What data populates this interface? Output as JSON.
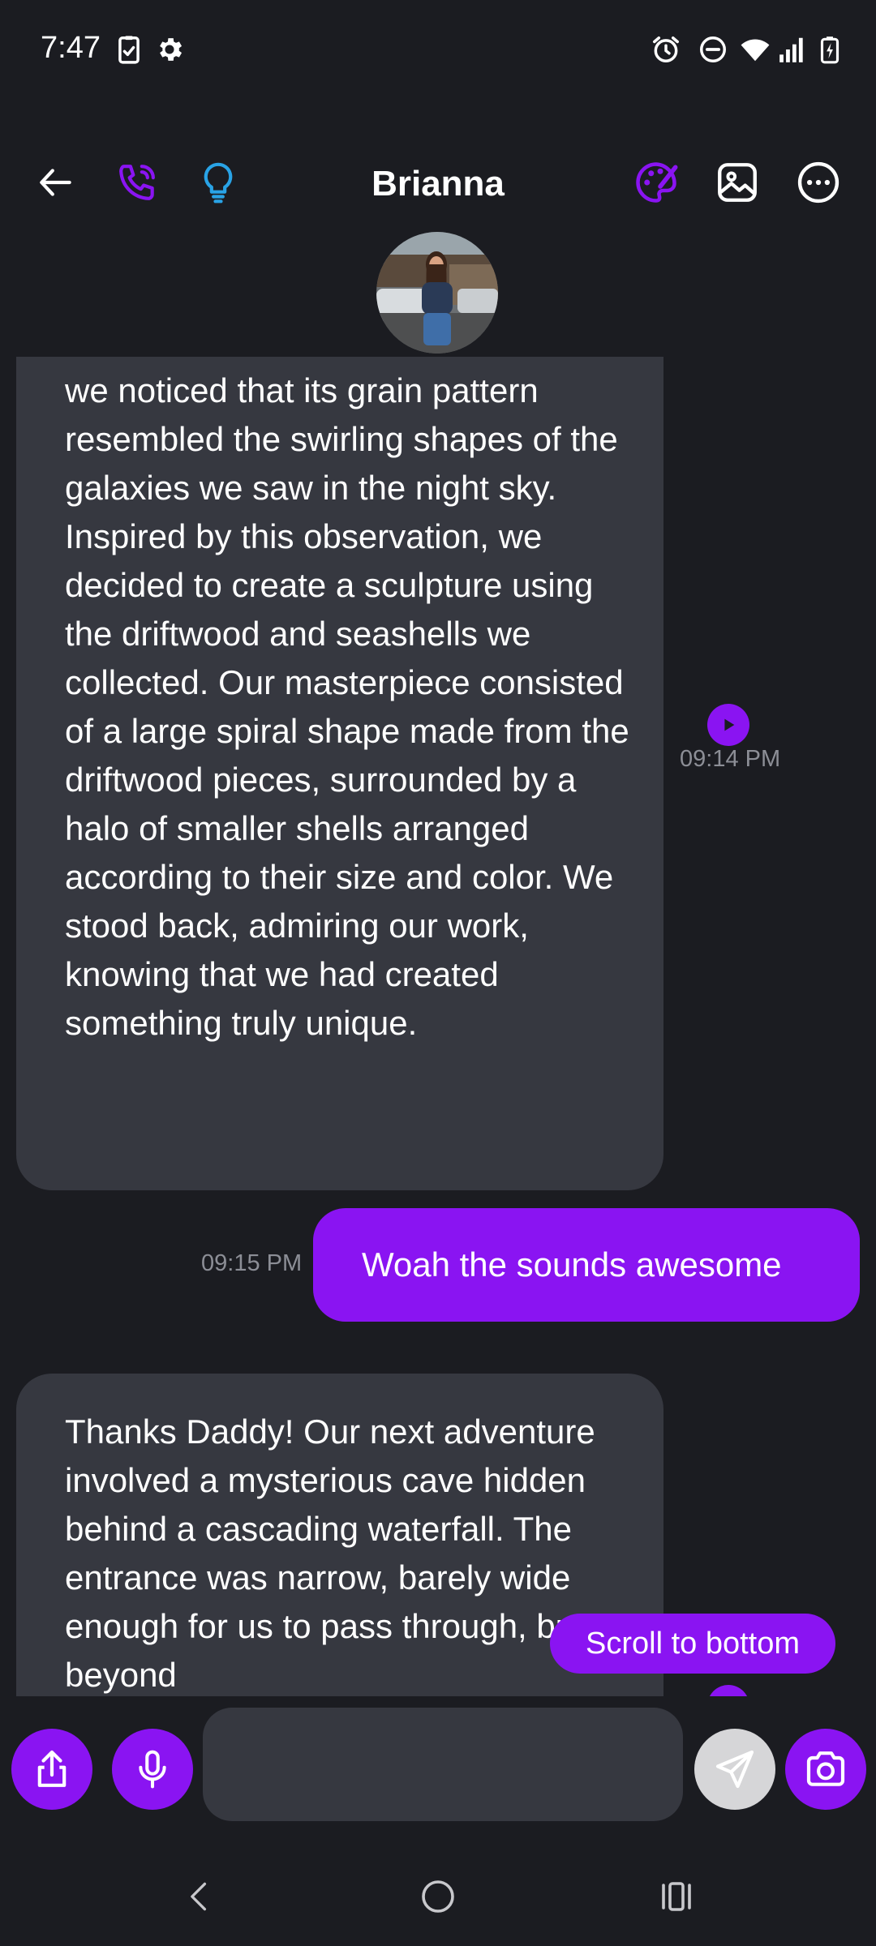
{
  "status_bar": {
    "time": "7:47",
    "left_icons": [
      "clipboard-check-icon",
      "gear-icon"
    ],
    "right_icons": [
      "alarm-icon",
      "do-not-disturb-icon",
      "wifi-icon",
      "signal-icon",
      "battery-charging-icon"
    ]
  },
  "header": {
    "contact_name": "Brianna",
    "icons": [
      "back-arrow-icon",
      "phone-icon",
      "lightbulb-icon",
      "palette-icon",
      "image-icon",
      "more-icon"
    ],
    "avatar_icon": "contact-avatar"
  },
  "messages": [
    {
      "sender": "contact",
      "text": "we noticed that its grain pattern resembled the swirling shapes of the galaxies we saw in the night sky. Inspired by this observation, we decided to create a sculpture using the driftwood and seashells we collected. Our masterpiece consisted of a large spiral shape made from the driftwood pieces, surrounded by a halo of smaller shells arranged according to their size and color. We stood back, admiring our work, knowing that we had created something truly unique.",
      "time": "09:14 PM"
    },
    {
      "sender": "user",
      "text": "Woah the sounds awesome",
      "time": "09:15 PM"
    },
    {
      "sender": "contact",
      "text": "Thanks Daddy! Our next adventure involved a mysterious cave hidden behind a cascading waterfall. The entrance was narrow, barely wide enough for us to pass through, but beyond"
    }
  ],
  "scroll_to_bottom_label": "Scroll to bottom",
  "input_bar": {
    "placeholder": "",
    "icons": [
      "share-icon",
      "microphone-icon",
      "send-icon",
      "camera-icon"
    ]
  },
  "nav_bar": {
    "icons": [
      "back-icon",
      "home-icon",
      "recents-icon"
    ]
  },
  "colors": {
    "background": "#1b1c21",
    "incoming_bubble": "#363840",
    "outgoing_bubble": "#8a14f2",
    "accent": "#8a14f2",
    "lightbulb": "#29a3e6",
    "timestamp": "#8c8e96",
    "send_button": "#d6d6d8"
  }
}
